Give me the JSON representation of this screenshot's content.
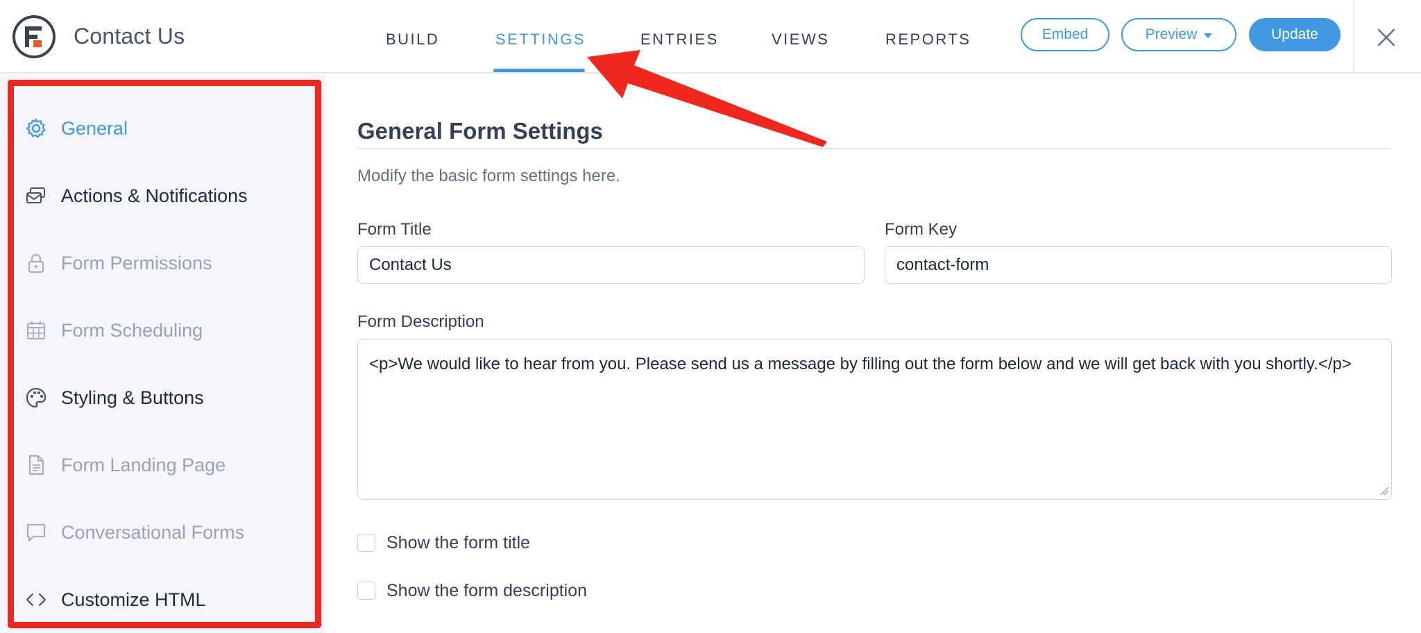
{
  "header": {
    "app_title": "Contact Us",
    "tabs": [
      {
        "label": "BUILD",
        "active": false
      },
      {
        "label": "SETTINGS",
        "active": true
      },
      {
        "label": "ENTRIES",
        "active": false
      },
      {
        "label": "VIEWS",
        "active": false
      },
      {
        "label": "REPORTS",
        "active": false
      }
    ],
    "buttons": {
      "embed": "Embed",
      "preview": "Preview",
      "update": "Update"
    },
    "logo_icon": "formidable-logo-icon",
    "close_icon": "close-icon"
  },
  "sidebar": {
    "items": [
      {
        "label": "General",
        "icon": "gear-icon",
        "state": "active"
      },
      {
        "label": "Actions & Notifications",
        "icon": "envelope-stack-icon",
        "state": "normal"
      },
      {
        "label": "Form Permissions",
        "icon": "lock-icon",
        "state": "muted"
      },
      {
        "label": "Form Scheduling",
        "icon": "calendar-icon",
        "state": "muted"
      },
      {
        "label": "Styling & Buttons",
        "icon": "palette-icon",
        "state": "normal"
      },
      {
        "label": "Form Landing Page",
        "icon": "document-icon",
        "state": "muted"
      },
      {
        "label": "Conversational Forms",
        "icon": "chat-bubble-icon",
        "state": "muted"
      },
      {
        "label": "Customize HTML",
        "icon": "code-icon",
        "state": "normal"
      }
    ]
  },
  "main": {
    "title": "General Form Settings",
    "subtitle": "Modify the basic form settings here.",
    "form_title": {
      "label": "Form Title",
      "value": "Contact Us"
    },
    "form_key": {
      "label": "Form Key",
      "value": "contact-form"
    },
    "form_description": {
      "label": "Form Description",
      "value": "<p>We would like to hear from you. Please send us a message by filling out the form below and we will get back with you shortly.</p>"
    },
    "checkboxes": [
      {
        "label": "Show the form title",
        "checked": false
      },
      {
        "label": "Show the form description",
        "checked": false
      }
    ]
  },
  "colors": {
    "accent": "#4199e1",
    "annotation": "#f0271c",
    "sidebar_bg": "#f5f6fb",
    "muted_text": "#98a2b3"
  }
}
